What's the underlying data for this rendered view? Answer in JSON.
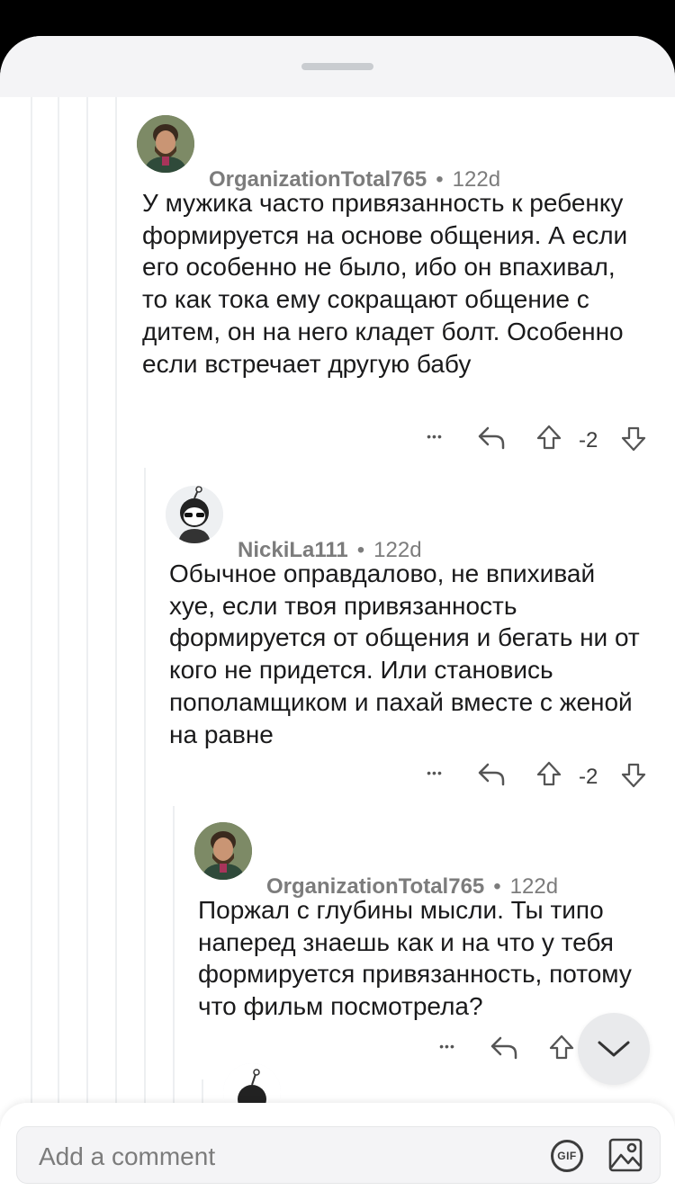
{
  "comments": [
    {
      "author": "OrganizationTotal765",
      "separator": "•",
      "age": "122d",
      "body": "У мужика часто привязанность к ребенку формируется на основе общения. А если его особенно не было, ибо он впахивал, то как тока ему сокращают общение с дитем, он на него кладет болт. Особенно если встречает другую бабу",
      "more": "•••",
      "score": "-2"
    },
    {
      "author": "NickiLa111",
      "separator": "•",
      "age": "122d",
      "body": "Обычное оправдалово, не впихивай хуе, если твоя привязанность формируется от общения и бегать ни от кого не придется. Или становись пополамщиком и пахай вместе с женой на равне",
      "more": "•••",
      "score": "-2"
    },
    {
      "author": "OrganizationTotal765",
      "separator": "•",
      "age": "122d",
      "body": "Поржал с глубины мысли. Ты типо наперед знаешь как и на что у тебя формируется привязанность, потому что фильм посмотрела?",
      "more": "•••"
    }
  ],
  "composer": {
    "placeholder": "Add a comment",
    "gif_label": "GIF"
  },
  "icons": {
    "reply": "reply-arrow-icon",
    "upvote": "upvote-arrow-icon",
    "downvote": "downvote-arrow-icon",
    "scroll": "chevron-down-icon",
    "image": "image-icon"
  }
}
